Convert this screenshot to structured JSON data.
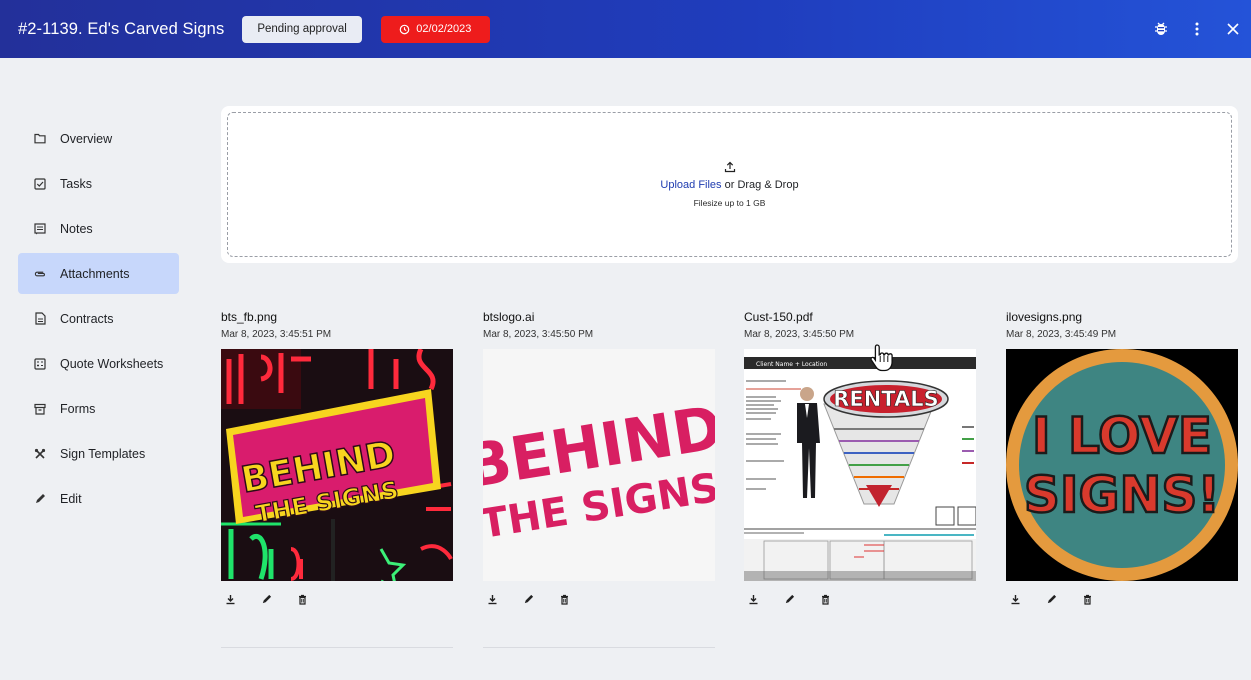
{
  "header": {
    "title": "#2-1139. Ed's Carved Signs",
    "status": "Pending approval",
    "due_date": "02/02/2023"
  },
  "sidebar": {
    "items": [
      {
        "label": "Overview",
        "icon": "folder-icon",
        "active": false
      },
      {
        "label": "Tasks",
        "icon": "checkbox-icon",
        "active": false
      },
      {
        "label": "Notes",
        "icon": "notes-icon",
        "active": false
      },
      {
        "label": "Attachments",
        "icon": "attachment-icon",
        "active": true
      },
      {
        "label": "Contracts",
        "icon": "document-icon",
        "active": false
      },
      {
        "label": "Quote Worksheets",
        "icon": "calculator-icon",
        "active": false
      },
      {
        "label": "Forms",
        "icon": "archive-icon",
        "active": false
      },
      {
        "label": "Sign Templates",
        "icon": "tools-icon",
        "active": false
      },
      {
        "label": "Edit",
        "icon": "pencil-icon",
        "active": false
      }
    ]
  },
  "upload": {
    "link_text": "Upload Files",
    "rest_text": " or Drag & Drop",
    "size_text": "Filesize up to 1 GB"
  },
  "files": [
    {
      "name": "bts_fb.png",
      "date": "Mar 8, 2023, 3:45:51 PM"
    },
    {
      "name": "btslogo.ai",
      "date": "Mar 8, 2023, 3:45:50 PM"
    },
    {
      "name": "Cust-150.pdf",
      "date": "Mar 8, 2023, 3:45:50 PM"
    },
    {
      "name": "ilovesigns.png",
      "date": "Mar 8, 2023, 3:45:49 PM"
    }
  ],
  "thumbnails": {
    "bts_fb": {
      "line1": "BEHIND",
      "line2": "THE SIGNS"
    },
    "btslogo": {
      "line1": "BEHIND",
      "line2": "THE SIGNS"
    },
    "cust150": {
      "header": "Client Name + Location",
      "banner": "RENTALS"
    },
    "ilovesigns": {
      "line1": "I LOVE",
      "line2": "SIGNS!"
    }
  },
  "colors": {
    "header_bg": "#1f3dbd",
    "date_pill": "#ee1c1c",
    "active_nav": "#c7d7fb",
    "link": "#1f3cb0"
  }
}
